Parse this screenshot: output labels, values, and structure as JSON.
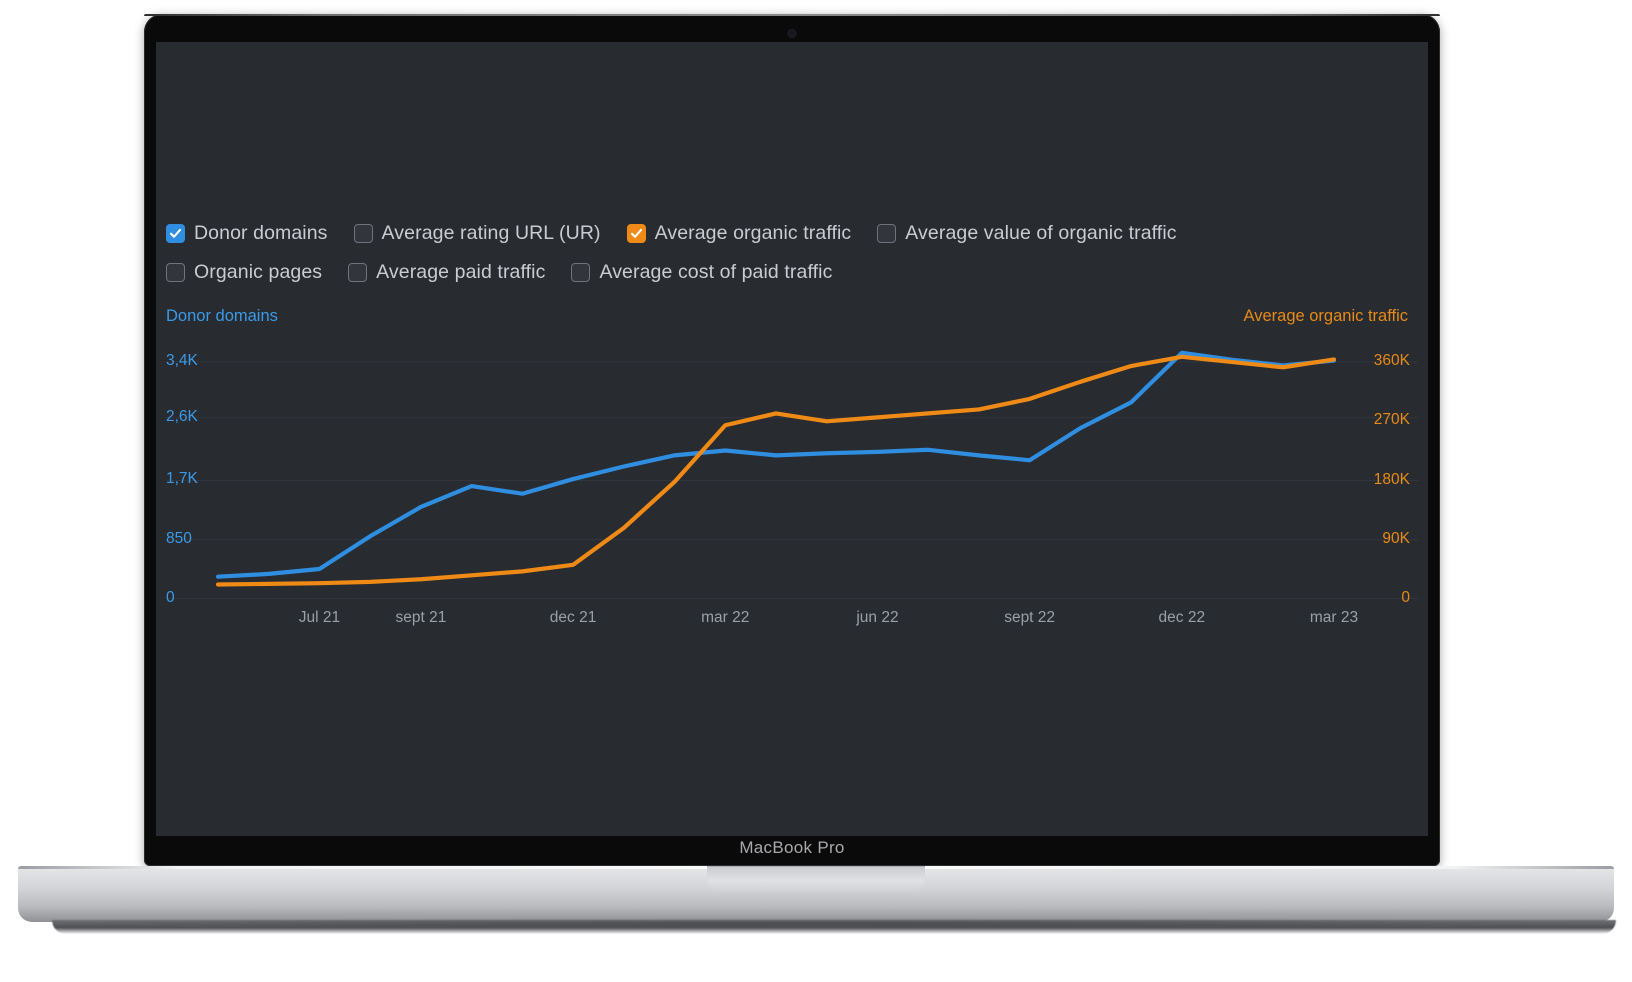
{
  "device": {
    "label": "MacBook Pro"
  },
  "legend": {
    "rows": [
      [
        {
          "label": "Donor domains",
          "checked": true,
          "color": "#2f8ee0"
        },
        {
          "label": "Average rating URL (UR)",
          "checked": false,
          "color": ""
        },
        {
          "label": "Average organic traffic",
          "checked": true,
          "color": "#ef8a16"
        },
        {
          "label": "Average value of organic traffic",
          "checked": false,
          "color": ""
        }
      ],
      [
        {
          "label": "Organic pages",
          "checked": false,
          "color": ""
        },
        {
          "label": "Average paid traffic",
          "checked": false,
          "color": ""
        },
        {
          "label": "Average cost of paid traffic",
          "checked": false,
          "color": ""
        }
      ]
    ]
  },
  "chart_data": {
    "type": "line",
    "title": "",
    "xlabel": "",
    "grid": true,
    "legend_position": "top",
    "axes": {
      "left": {
        "name": "Donor domains",
        "color": "#3b9ae8",
        "ticks": [
          "0",
          "850",
          "1,7K",
          "2,6K",
          "3,4K"
        ],
        "tick_values": [
          0,
          850,
          1700,
          2600,
          3400
        ],
        "ylim": [
          0,
          3700
        ]
      },
      "right": {
        "name": "Average organic traffic",
        "color": "#e88a16",
        "ticks": [
          "0",
          "90K",
          "180K",
          "270K",
          "360K"
        ],
        "tick_values": [
          0,
          90000,
          180000,
          270000,
          360000
        ],
        "ylim": [
          0,
          392000
        ]
      }
    },
    "x_tick_labels": [
      "Jul 21",
      "sept 21",
      "dec 21",
      "mar 22",
      "jun 22",
      "sept 22",
      "dec 22",
      "mar 23"
    ],
    "x": [
      "may 21",
      "jun 21",
      "Jul 21",
      "aug 21",
      "sept 21",
      "oct 21",
      "nov 21",
      "dec 21",
      "jan 22",
      "feb 22",
      "mar 22",
      "apr 22",
      "may 22",
      "jun 22",
      "jul 22",
      "aug 22",
      "sept 22",
      "oct 22",
      "nov 22",
      "dec 22",
      "jan 23",
      "feb 23",
      "mar 23"
    ],
    "series": [
      {
        "name": "Donor domains",
        "color": "#2f8ee0",
        "axis": "left",
        "values": [
          320,
          360,
          430,
          900,
          1320,
          1620,
          1510,
          1720,
          1900,
          2060,
          2130,
          2060,
          2090,
          2110,
          2140,
          2060,
          1990,
          2450,
          2820,
          3530,
          3430,
          3350,
          3420
        ]
      },
      {
        "name": "Average organic traffic",
        "color": "#ef8a16",
        "axis": "right",
        "values": [
          22000,
          23000,
          24000,
          26000,
          30000,
          36000,
          42000,
          52000,
          108000,
          178000,
          264000,
          282000,
          270000,
          276000,
          282000,
          288000,
          304000,
          330000,
          354000,
          368000,
          360000,
          352000,
          364000
        ]
      }
    ]
  }
}
